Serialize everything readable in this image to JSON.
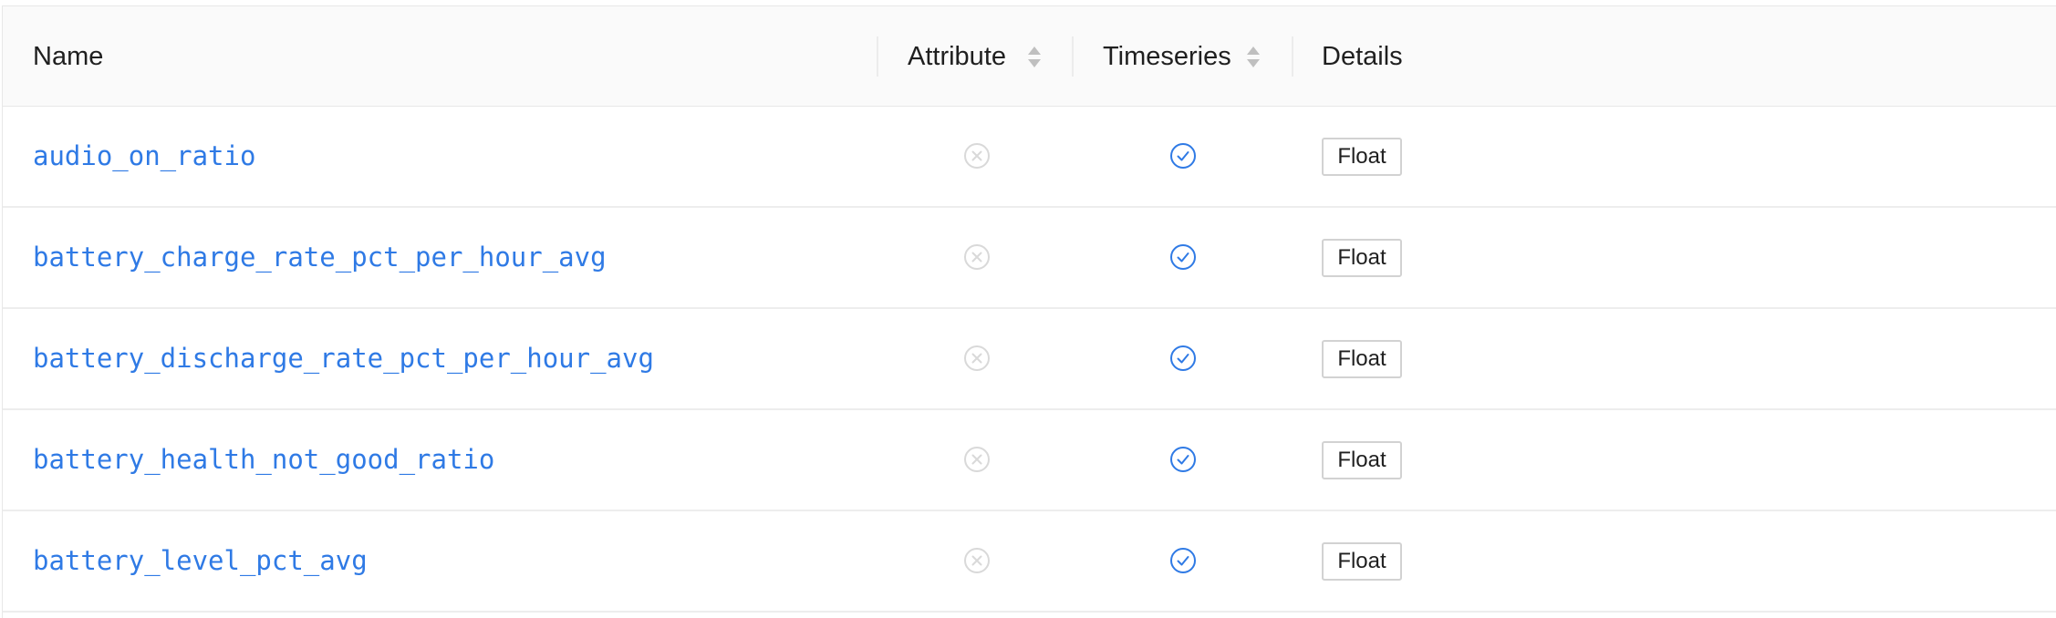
{
  "columns": {
    "name": "Name",
    "attribute": "Attribute",
    "timeseries": "Timeseries",
    "details": "Details"
  },
  "colors": {
    "link": "#2f7ae5",
    "check": "#2f7ae5",
    "cross": "#d9d9d9"
  },
  "rows": [
    {
      "name": "audio_on_ratio",
      "attribute": "x-circle-icon",
      "timeseries": "check-circle-icon",
      "details": "Float"
    },
    {
      "name": "battery_charge_rate_pct_per_hour_avg",
      "attribute": "x-circle-icon",
      "timeseries": "check-circle-icon",
      "details": "Float"
    },
    {
      "name": "battery_discharge_rate_pct_per_hour_avg",
      "attribute": "x-circle-icon",
      "timeseries": "check-circle-icon",
      "details": "Float"
    },
    {
      "name": "battery_health_not_good_ratio",
      "attribute": "x-circle-icon",
      "timeseries": "check-circle-icon",
      "details": "Float"
    },
    {
      "name": "battery_level_pct_avg",
      "attribute": "x-circle-icon",
      "timeseries": "check-circle-icon",
      "details": "Float"
    }
  ]
}
